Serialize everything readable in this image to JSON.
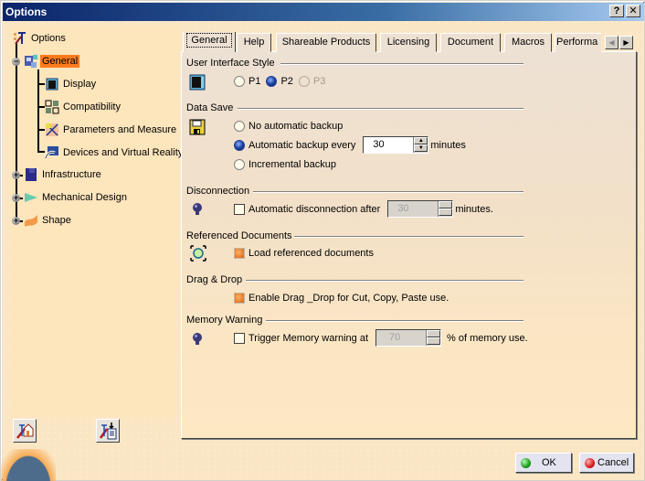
{
  "window": {
    "title": "Options",
    "help_label": "?",
    "close_label": "✕"
  },
  "tree": {
    "root": "Options",
    "items": [
      {
        "label": "General",
        "selected": true,
        "expanded": true,
        "icon": "general-icon"
      },
      {
        "label": "Display",
        "icon": "display-icon"
      },
      {
        "label": "Compatibility",
        "icon": "compatibility-icon"
      },
      {
        "label": "Parameters and Measure",
        "icon": "parameters-icon"
      },
      {
        "label": "Devices and Virtual Reality",
        "icon": "devices-icon"
      },
      {
        "label": "Infrastructure",
        "expandable": true,
        "icon": "infrastructure-icon"
      },
      {
        "label": "Mechanical Design",
        "expandable": true,
        "icon": "mechanical-design-icon"
      },
      {
        "label": "Shape",
        "expandable": true,
        "icon": "shape-icon"
      }
    ]
  },
  "tabs": [
    {
      "label": "General",
      "active": true
    },
    {
      "label": "Help"
    },
    {
      "label": "Shareable Products"
    },
    {
      "label": "Licensing"
    },
    {
      "label": "Document"
    },
    {
      "label": "Macros"
    },
    {
      "label": "Performa"
    }
  ],
  "groups": {
    "ui_style": {
      "title": "User Interface Style",
      "options": [
        {
          "label": "P1",
          "checked": false
        },
        {
          "label": "P2",
          "checked": true
        },
        {
          "label": "P3",
          "checked": false,
          "disabled": true
        }
      ]
    },
    "data_save": {
      "title": "Data Save",
      "no_backup": "No automatic backup",
      "auto_backup": "Automatic backup every",
      "auto_backup_value": "30",
      "auto_backup_unit": "minutes",
      "incremental": "Incremental backup",
      "selected": "auto_backup"
    },
    "disconnection": {
      "title": "Disconnection",
      "label": "Automatic disconnection after",
      "value": "30",
      "unit": "minutes.",
      "checked": false
    },
    "referenced_docs": {
      "title": "Referenced Documents",
      "label": "Load referenced documents",
      "checked": true
    },
    "drag_drop": {
      "title": "Drag & Drop",
      "label": "Enable Drag _Drop for Cut, Copy, Paste use.",
      "checked": true
    },
    "memory_warning": {
      "title": "Memory Warning",
      "label": "Trigger Memory warning at",
      "value": "70",
      "unit": "% of memory use.",
      "checked": false
    }
  },
  "buttons": {
    "ok": "OK",
    "cancel": "Cancel"
  },
  "colors": {
    "selection": "#ff7a1a",
    "title_bar_start": "#0a246a",
    "title_bar_end": "#a6caf0",
    "panel_bg": "#fde5bc"
  }
}
